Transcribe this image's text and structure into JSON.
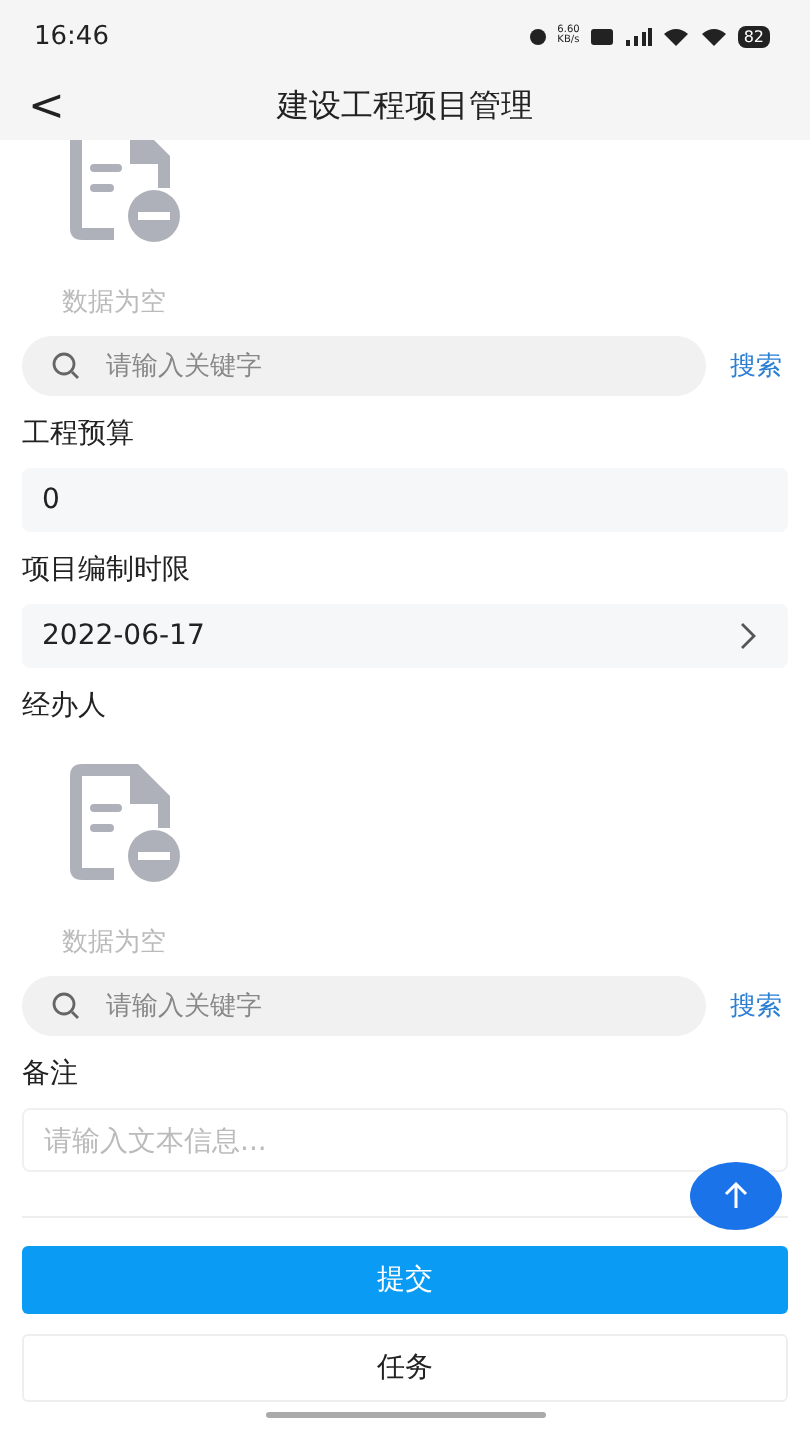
{
  "status_bar": {
    "time": "16:46",
    "net_speed": "6.60",
    "net_unit": "KB/s",
    "battery": "82"
  },
  "header": {
    "back": "<",
    "title": "建设工程项目管理"
  },
  "sections": [
    {
      "kind": "picker",
      "top_cut": true,
      "empty_text": "数据为空",
      "search": {
        "placeholder": "请输入关键字",
        "button": "搜索"
      }
    },
    {
      "kind": "field",
      "label": "工程预算",
      "value": "0"
    },
    {
      "kind": "date",
      "label": "项目编制时限",
      "value": "2022-06-17"
    },
    {
      "kind": "picker",
      "top_cut": false,
      "label": "经办人",
      "empty_text": "数据为空",
      "search": {
        "placeholder": "请输入关键字",
        "button": "搜索"
      }
    },
    {
      "kind": "textarea",
      "label": "备注",
      "placeholder": "请输入文本信息..."
    }
  ],
  "buttons": [
    {
      "label": "提交",
      "kind": "primary"
    },
    {
      "label": "任务",
      "kind": "secondary"
    }
  ]
}
